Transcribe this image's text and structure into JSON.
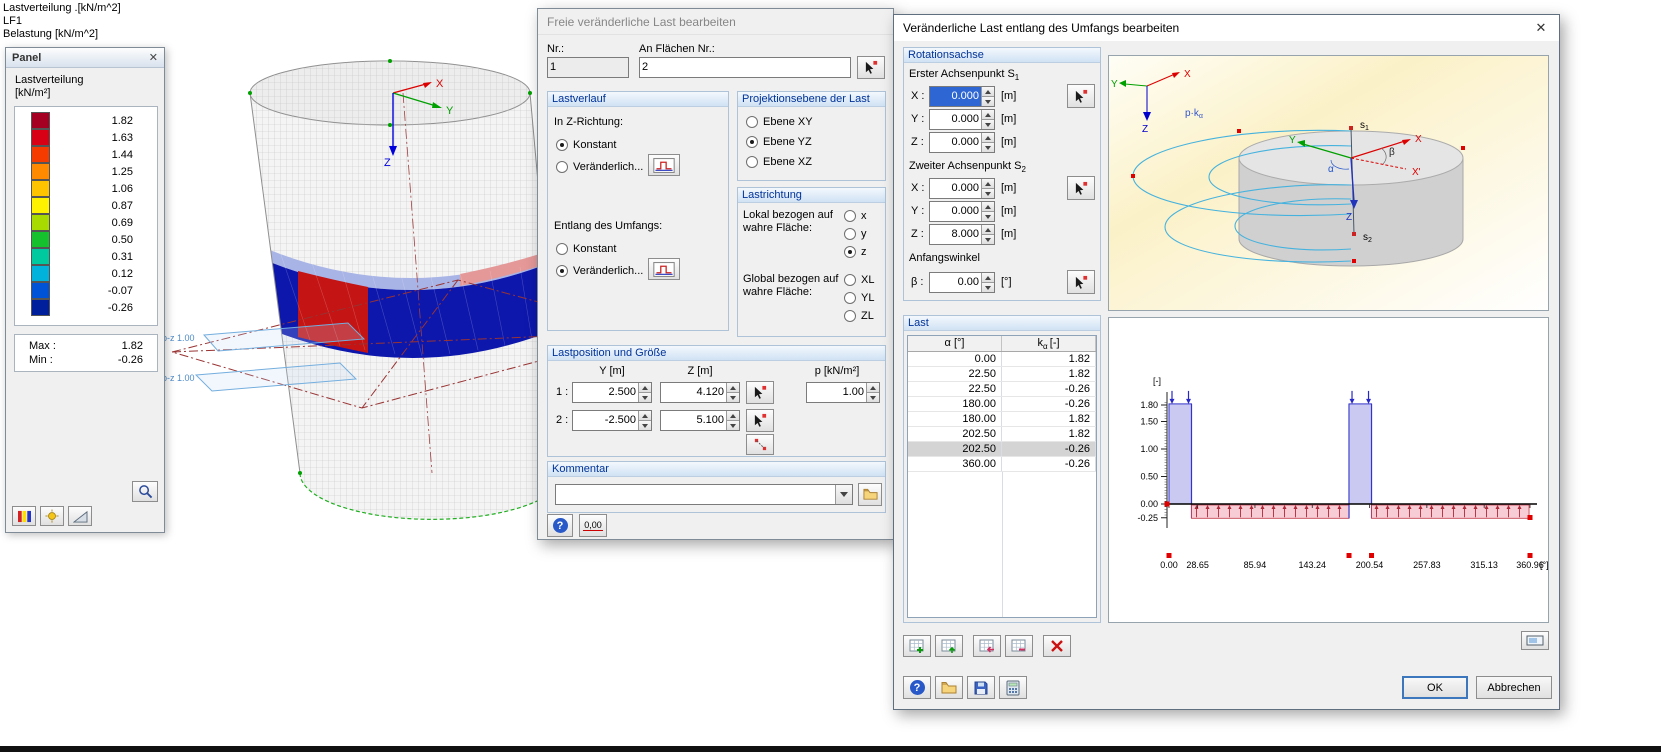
{
  "icons": {
    "close": "✕",
    "help": "?"
  },
  "viewport": {
    "labels": [
      "Lastverteilung .[kN/m^2]",
      "LF1",
      "Belastung [kN/m^2]"
    ],
    "plane_label_1": "p-z 1.00",
    "plane_label_2": "p-z 1.00"
  },
  "panel": {
    "title": "Panel",
    "legend_title": "Lastverteilung",
    "legend_unit": "[kN/m²]",
    "legend": [
      {
        "value": "1.82",
        "color": "#a50021"
      },
      {
        "value": "1.63",
        "color": "#d80014"
      },
      {
        "value": "1.44",
        "color": "#f53b00"
      },
      {
        "value": "1.25",
        "color": "#ff8a00"
      },
      {
        "value": "1.06",
        "color": "#ffc400"
      },
      {
        "value": "0.87",
        "color": "#fff200"
      },
      {
        "value": "0.69",
        "color": "#a8dc00"
      },
      {
        "value": "0.50",
        "color": "#15c22d"
      },
      {
        "value": "0.31",
        "color": "#00c9a0"
      },
      {
        "value": "0.12",
        "color": "#00b2dc"
      },
      {
        "value": "-0.07",
        "color": "#0053d6"
      },
      {
        "value": "-0.26",
        "color": "#001f9c"
      }
    ],
    "max_label": "Max :",
    "max_value": "1.82",
    "min_label": "Min :",
    "min_value": "-0.26"
  },
  "dialog_free_load": {
    "title": "Freie veränderliche Last bearbeiten",
    "nr": {
      "label": "Nr.:",
      "value": "1"
    },
    "surfaces": {
      "label": "An Flächen Nr.:",
      "value": "2"
    },
    "load_course": {
      "title": "Lastverlauf",
      "z_label": "In Z-Richtung:",
      "z_options": [
        {
          "label": "Konstant",
          "checked": true
        },
        {
          "label": "Veränderlich...",
          "checked": false
        }
      ],
      "circumference_label": "Entlang des Umfangs:",
      "circ_options": [
        {
          "label": "Konstant",
          "checked": false
        },
        {
          "label": "Veränderlich...",
          "checked": true
        }
      ]
    },
    "projection": {
      "title": "Projektionsebene der Last",
      "options": [
        {
          "label": "Ebene XY",
          "checked": false
        },
        {
          "label": "Ebene YZ",
          "checked": true
        },
        {
          "label": "Ebene XZ",
          "checked": false
        }
      ]
    },
    "direction": {
      "title": "Lastrichtung",
      "local_label_1": "Lokal bezogen auf",
      "local_label_2": "wahre Fläche:",
      "local_options": [
        {
          "label": "x",
          "checked": false
        },
        {
          "label": "y",
          "checked": false
        },
        {
          "label": "z",
          "checked": true
        }
      ],
      "global_label_1": "Global bezogen auf",
      "global_label_2": "wahre Fläche:",
      "global_options": [
        {
          "label": "XL",
          "checked": false
        },
        {
          "label": "YL",
          "checked": false
        },
        {
          "label": "ZL",
          "checked": false
        }
      ]
    },
    "position": {
      "title": "Lastposition und Größe",
      "col_y": "Y [m]",
      "col_z": "Z [m]",
      "col_p": "p  [kN/m²]",
      "rows": [
        {
          "label": "1 :",
          "y": "2.500",
          "z": "4.120",
          "p": "1.00"
        },
        {
          "label": "2 :",
          "y": "-2.500",
          "z": "5.100"
        }
      ]
    },
    "comment": {
      "title": "Kommentar",
      "value": ""
    },
    "zero_button": "0,00"
  },
  "dialog_circumference": {
    "title": "Veränderliche Last entlang des Umfangs bearbeiten",
    "rotation_axis": {
      "title": "Rotationsachse",
      "point1_label": "Erster Achsenpunkt S",
      "point1_sub": "1",
      "point2_label": "Zweiter Achsenpunkt S",
      "point2_sub": "2",
      "x_label": "X :",
      "y_label": "Y :",
      "z_label": "Z :",
      "unit": "[m]",
      "p1": {
        "x": "0.000",
        "y": "0.000",
        "z": "0.000"
      },
      "p2": {
        "x": "0.000",
        "y": "0.000",
        "z": "8.000"
      },
      "angle_label": "Anfangswinkel",
      "beta_label": "β :",
      "beta_value": "0.00",
      "beta_unit": "[°]"
    },
    "load_table": {
      "title": "Last",
      "col_alpha": "α [°]",
      "col_k_base": "k",
      "col_k_sub": "α",
      "col_k_unit": "[-]",
      "selected_row": 6,
      "rows": [
        {
          "alpha": "0.00",
          "k": "1.82"
        },
        {
          "alpha": "22.50",
          "k": "1.82"
        },
        {
          "alpha": "22.50",
          "k": "-0.26"
        },
        {
          "alpha": "180.00",
          "k": "-0.26"
        },
        {
          "alpha": "180.00",
          "k": "1.82"
        },
        {
          "alpha": "202.50",
          "k": "1.82"
        },
        {
          "alpha": "202.50",
          "k": "-0.26"
        },
        {
          "alpha": "360.00",
          "k": "-0.26"
        }
      ]
    },
    "ok": "OK",
    "cancel": "Abbrechen"
  },
  "picture": {
    "x": "X",
    "y": "Y",
    "z": "Z",
    "x_prime": "X'",
    "alpha": "α",
    "beta": "β",
    "pk_base": "p·k",
    "pk_sub": "α",
    "s_base": "s",
    "s1_sub": "1",
    "s2_sub": "2"
  },
  "chart_data": {
    "type": "area-step",
    "title": "",
    "x_unit": "[°]",
    "y_unit": "[-]",
    "x_range": [
      0,
      360.96
    ],
    "x_ticks": [
      0,
      28.65,
      85.94,
      143.24,
      200.54,
      257.83,
      315.13,
      360.96
    ],
    "x_tick_labels": [
      "0.00",
      "28.65",
      "85.94",
      "143.24",
      "200.54",
      "257.83",
      "315.13",
      "360.96"
    ],
    "y_ticks": [
      1.8,
      1.5,
      1.0,
      0.5,
      0.0,
      -0.25
    ],
    "y_tick_labels": [
      "1.80",
      "1.50",
      "1.00",
      "0.50",
      "0.00",
      "-0.25"
    ],
    "points": [
      [
        0,
        1.82
      ],
      [
        22.5,
        1.82
      ],
      [
        22.5,
        -0.26
      ],
      [
        180,
        -0.26
      ],
      [
        180,
        1.82
      ],
      [
        202.5,
        1.82
      ],
      [
        202.5,
        -0.26
      ],
      [
        360,
        -0.26
      ]
    ],
    "marker_x": [
      0,
      180,
      202.5,
      360.96
    ],
    "positive_color": "#c9c9f2",
    "negative_color": "#f7ccd4",
    "grid": false,
    "legend": false
  }
}
